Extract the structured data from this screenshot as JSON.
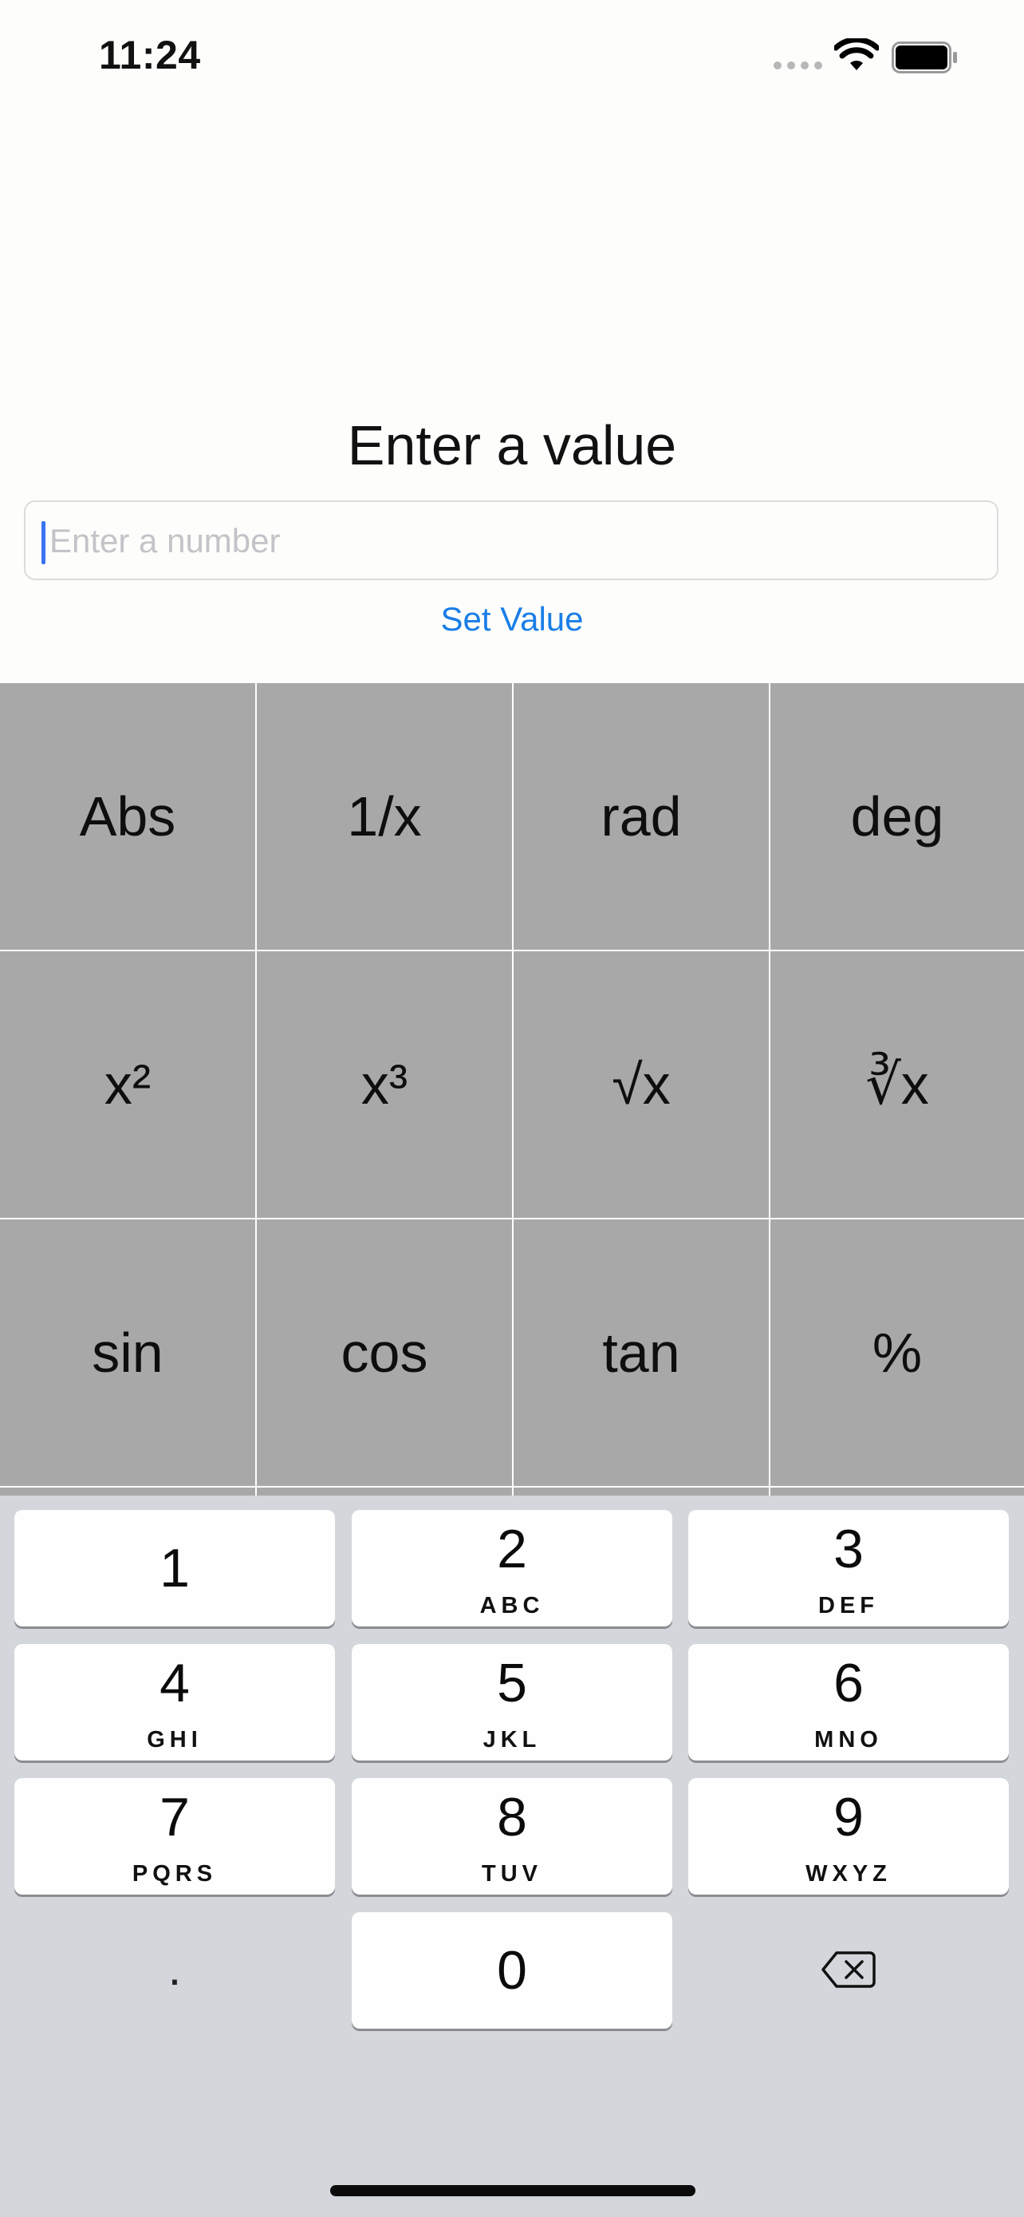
{
  "status_bar": {
    "time": "11:24",
    "signal_icon": "cellular-signal-icon",
    "wifi_icon": "wifi-icon",
    "battery_icon": "battery-full-icon"
  },
  "form": {
    "title": "Enter a value",
    "input_placeholder": "Enter a number",
    "input_value": "",
    "set_value_label": "Set Value",
    "link_color": "#1a7ee6"
  },
  "functions": [
    [
      "Abs",
      "1/x",
      "rad",
      "deg"
    ],
    [
      "x²",
      "x³",
      "√x",
      "∛x"
    ],
    [
      "sin",
      "cos",
      "tan",
      "%"
    ]
  ],
  "keyboard": {
    "keys": [
      {
        "digit": "1",
        "letters": ""
      },
      {
        "digit": "2",
        "letters": "ABC"
      },
      {
        "digit": "3",
        "letters": "DEF"
      },
      {
        "digit": "4",
        "letters": "GHI"
      },
      {
        "digit": "5",
        "letters": "JKL"
      },
      {
        "digit": "6",
        "letters": "MNO"
      },
      {
        "digit": "7",
        "letters": "PQRS"
      },
      {
        "digit": "8",
        "letters": "TUV"
      },
      {
        "digit": "9",
        "letters": "WXYZ"
      }
    ],
    "decimal": ".",
    "zero": "0",
    "delete_icon": "backspace-icon"
  }
}
